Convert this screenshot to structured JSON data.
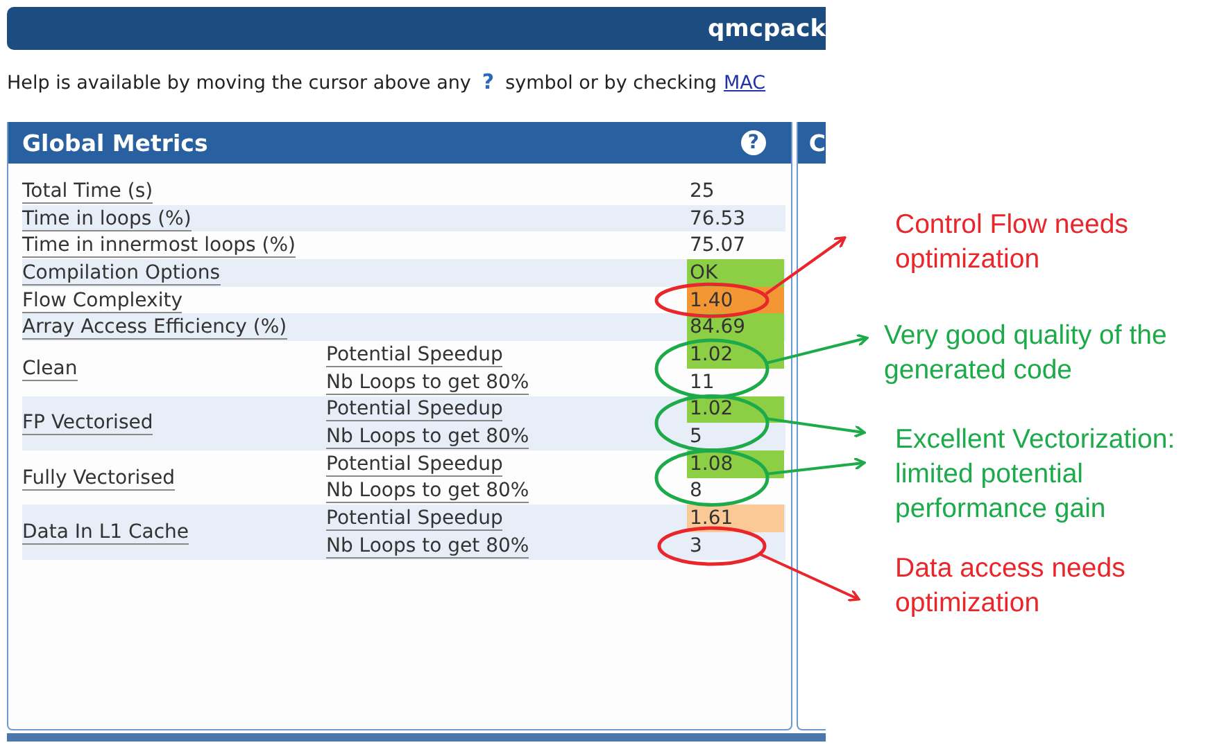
{
  "header": {
    "title": "qmcpack"
  },
  "help": {
    "text_before": "Help is available by moving the cursor above any",
    "symbol": "?",
    "text_after": "symbol or by checking",
    "link": "MAC"
  },
  "panels": [
    {
      "title": "Global Metrics",
      "help_symbol": "?"
    },
    {
      "title": "C"
    }
  ],
  "metrics": [
    {
      "kind": "single",
      "label": "Total Time (s)",
      "value": "25"
    },
    {
      "kind": "single",
      "label": "Time in loops (%)",
      "value": "76.53"
    },
    {
      "kind": "single",
      "label": "Time in innermost loops (%)",
      "value": "75.07"
    },
    {
      "kind": "single",
      "label": "Compilation Options",
      "value": "OK",
      "color": "#8ccf45"
    },
    {
      "kind": "single",
      "label": "Flow Complexity",
      "value": "1.40",
      "color": "#f39634"
    },
    {
      "kind": "single",
      "label": "Array Access Efficiency (%)",
      "value": "84.69",
      "color": "#8ccf45"
    },
    {
      "kind": "group",
      "label": "Clean",
      "rows": [
        {
          "label": "Potential Speedup",
          "value": "1.02",
          "color": "#8ccf45"
        },
        {
          "label": "Nb Loops to get 80%",
          "value": "11"
        }
      ]
    },
    {
      "kind": "group",
      "label": "FP Vectorised",
      "rows": [
        {
          "label": "Potential Speedup",
          "value": "1.02",
          "color": "#8ccf45"
        },
        {
          "label": "Nb Loops to get 80%",
          "value": "5"
        }
      ]
    },
    {
      "kind": "group",
      "label": "Fully Vectorised",
      "rows": [
        {
          "label": "Potential Speedup",
          "value": "1.08",
          "color": "#8ccf45"
        },
        {
          "label": "Nb Loops to get 80%",
          "value": "8"
        }
      ]
    },
    {
      "kind": "group",
      "label": "Data In L1 Cache",
      "rows": [
        {
          "label": "Potential Speedup",
          "value": "1.61",
          "color": "#fbc995"
        },
        {
          "label": "Nb Loops to get 80%",
          "value": "3"
        }
      ]
    }
  ],
  "annotations": [
    {
      "lines": [
        "Control Flow needs",
        "optimization"
      ],
      "color": "#e8262b"
    },
    {
      "lines": [
        "Very good quality of the",
        "generated code"
      ],
      "color": "#1daa4a"
    },
    {
      "lines": [
        "Excellent Vectorization:",
        "limited potential",
        "performance gain"
      ],
      "color": "#1daa4a"
    },
    {
      "lines": [
        "Data access needs",
        "optimization"
      ],
      "color": "#e8262b"
    }
  ]
}
